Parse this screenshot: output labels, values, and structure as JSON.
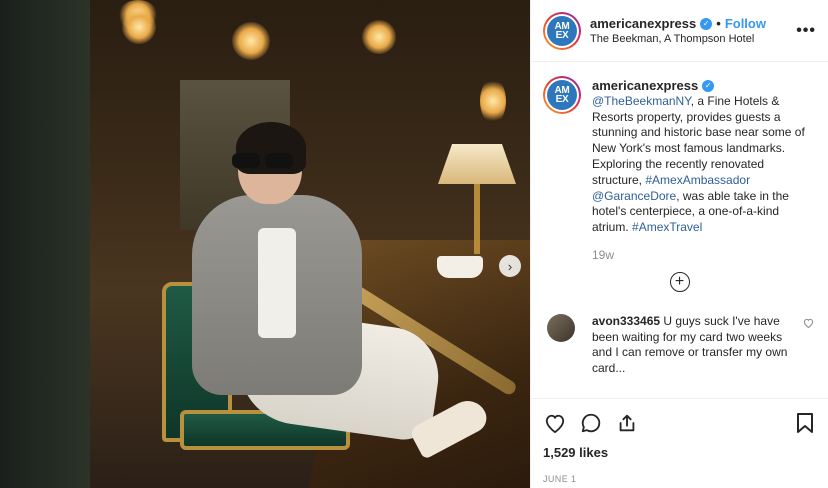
{
  "post": {
    "username": "americanexpress",
    "follow_label": "Follow",
    "separator": "•",
    "location": "The Beekman, A Thompson Hotel",
    "more_label": "•••",
    "avatar_text_top": "AM",
    "avatar_text_bottom": "EX"
  },
  "caption": {
    "username": "americanexpress",
    "mention1": "@TheBeekmanNY",
    "text1": ", a Fine Hotels & Resorts property, provides guests a stunning and historic base near some of New York's most famous landmarks. Exploring the recently renovated structure, ",
    "tag1": "#AmexAmbassador",
    "space": " ",
    "mention2": "@GaranceDore",
    "text2": ", was able take in the hotel's centerpiece, a one-of-a-kind atrium. ",
    "tag2": "#AmexTravel",
    "time_ago": "19w"
  },
  "load_more": "+",
  "comments": [
    {
      "username": "avon333465",
      "text": "U guys suck I've have been waiting for my card two weeks and I can remove or transfer my own card..."
    }
  ],
  "actions": {
    "likes": "1,529 likes",
    "date": "JUNE 1"
  },
  "photo": {
    "next_arrow": "›"
  },
  "colors": {
    "accent": "#3897f0",
    "amex_blue": "#2e77bb",
    "link": "#2e5f99"
  }
}
